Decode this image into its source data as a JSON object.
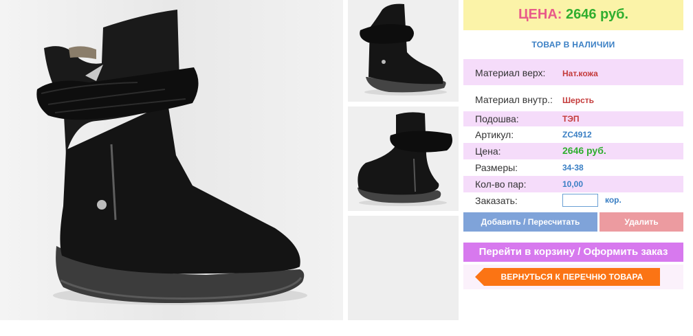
{
  "price_banner": {
    "label": "ЦЕНА:",
    "value": "2646 руб."
  },
  "stock_status": "ТОВАР В НАЛИЧИИ",
  "specs": [
    {
      "key": "Материал верх:",
      "value": "Нат.кожа"
    },
    {
      "key": "Материал внутр.:",
      "value": "Шерсть"
    },
    {
      "key": "Подошва:",
      "value": "ТЭП"
    },
    {
      "key": "Артикул:",
      "value": "ZC4912"
    },
    {
      "key": "Цена:",
      "value": "2646 руб."
    },
    {
      "key": "Размеры:",
      "value": "34-38"
    },
    {
      "key": "Кол-во пар:",
      "value": "10,00"
    }
  ],
  "order": {
    "label": "Заказать:",
    "value": "",
    "unit": "кор."
  },
  "buttons": {
    "add": "Добавить / Пересчитать",
    "delete": "Удалить",
    "cart": "Перейти в корзину / Оформить заказ",
    "back": "ВЕРНУТЬСЯ К ПЕРЕЧНЮ ТОВАРА"
  },
  "colors": {
    "banner_bg": "#fbf3a8",
    "price_label": "#e85a8a",
    "price_value": "#2fae2f",
    "row_highlight": "#f5dcfa",
    "link_blue": "#3a7fc4",
    "add_button": "#7fa3d9",
    "delete_button": "#ec9ba0",
    "cart_button": "#d779ee",
    "back_button": "#fb7414"
  },
  "images": {
    "main": "boot-photo-main",
    "thumbs": [
      "boot-photo-front",
      "boot-photo-side",
      "boot-photo-empty"
    ]
  }
}
